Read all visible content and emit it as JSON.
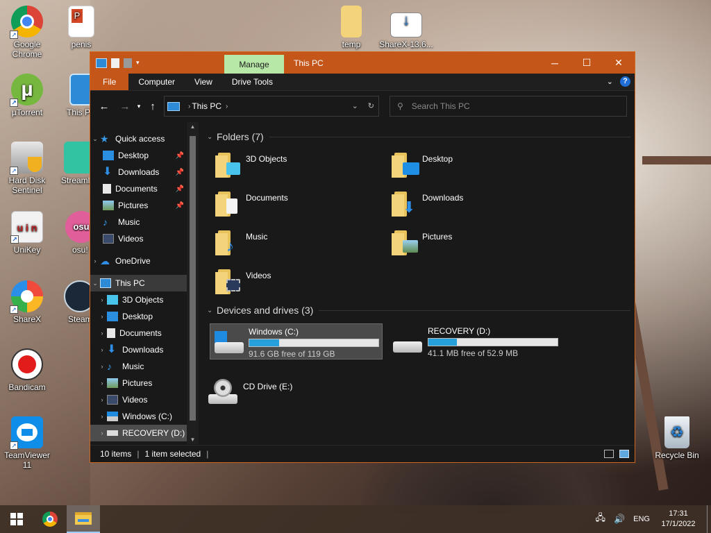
{
  "desktop": {
    "icons": [
      {
        "label": "Google Chrome"
      },
      {
        "label": "penis"
      },
      {
        "label": "µTorrent"
      },
      {
        "label": "This PC"
      },
      {
        "label": "Hard Disk Sentinel"
      },
      {
        "label": "Streamlabs OBS"
      },
      {
        "label": "UniKey"
      },
      {
        "label": "osu!"
      },
      {
        "label": "ShareX"
      },
      {
        "label": "Steam"
      },
      {
        "label": "Bandicam"
      },
      {
        "label": "TeamViewer 11"
      },
      {
        "label": "temp"
      },
      {
        "label": "ShareX-13.6..."
      },
      {
        "label": "Recycle Bin"
      }
    ]
  },
  "window": {
    "manage_tab": "Manage",
    "title": "This PC",
    "controls": {
      "minimize": "─",
      "maximize": "☐",
      "close": "✕"
    },
    "ribbon_tabs": [
      "File",
      "Computer",
      "View",
      "Drive Tools"
    ],
    "address": {
      "crumb": "This PC"
    },
    "search": {
      "placeholder": "Search This PC"
    },
    "nav": [
      {
        "label": "Quick access"
      },
      {
        "label": "Desktop"
      },
      {
        "label": "Downloads"
      },
      {
        "label": "Documents"
      },
      {
        "label": "Pictures"
      },
      {
        "label": "Music"
      },
      {
        "label": "Videos"
      },
      {
        "label": "OneDrive"
      },
      {
        "label": "This PC"
      },
      {
        "label": "3D Objects"
      },
      {
        "label": "Desktop"
      },
      {
        "label": "Documents"
      },
      {
        "label": "Downloads"
      },
      {
        "label": "Music"
      },
      {
        "label": "Pictures"
      },
      {
        "label": "Videos"
      },
      {
        "label": "Windows (C:)"
      },
      {
        "label": "RECOVERY (D:)"
      }
    ],
    "folders_header": "Folders (7)",
    "folders": [
      {
        "label": "3D Objects"
      },
      {
        "label": "Desktop"
      },
      {
        "label": "Documents"
      },
      {
        "label": "Downloads"
      },
      {
        "label": "Music"
      },
      {
        "label": "Pictures"
      },
      {
        "label": "Videos"
      }
    ],
    "drives_header": "Devices and drives (3)",
    "drives": [
      {
        "name": "Windows (C:)",
        "free": "91.6 GB free of 119 GB",
        "used_fraction": 0.23
      },
      {
        "name": "RECOVERY (D:)",
        "free": "41.1 MB free of 52.9 MB",
        "used_fraction": 0.22
      },
      {
        "name": "CD Drive (E:)"
      }
    ],
    "status": {
      "items": "10 items",
      "selected": "1 item selected"
    }
  },
  "taskbar": {
    "lang": "ENG",
    "time": "17:31",
    "date": "17/1/2022"
  },
  "colors": {
    "accent": "#c4561a",
    "manage_tab": "#b8e8a8",
    "drive_bar": "#26a0da",
    "window_bg": "#191919"
  }
}
